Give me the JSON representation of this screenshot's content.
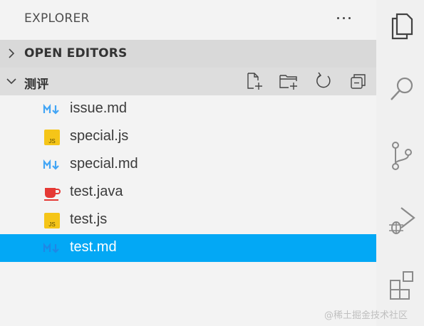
{
  "explorer": {
    "title": "EXPLORER",
    "more_icon": "ellipsis-icon"
  },
  "open_editors": {
    "label": "OPEN EDITORS",
    "expanded": false
  },
  "folder": {
    "label": "测评",
    "expanded": true,
    "tools": [
      "new-file-icon",
      "new-folder-icon",
      "refresh-icon",
      "collapse-all-icon"
    ]
  },
  "files": [
    {
      "name": "issue.md",
      "icon": "markdown-icon",
      "selected": false
    },
    {
      "name": "special.js",
      "icon": "javascript-icon",
      "selected": false
    },
    {
      "name": "special.md",
      "icon": "markdown-icon",
      "selected": false
    },
    {
      "name": "test.java",
      "icon": "java-icon",
      "selected": false
    },
    {
      "name": "test.js",
      "icon": "javascript-icon",
      "selected": false
    },
    {
      "name": "test.md",
      "icon": "markdown-icon",
      "selected": true
    }
  ],
  "activity_bar": [
    "files-icon",
    "search-icon",
    "source-control-icon",
    "run-debug-icon",
    "extensions-icon"
  ],
  "colors": {
    "background": "#f3f3f3",
    "section_header": "#d9d9d9",
    "selected_row": "#03a8f5",
    "markdown_icon": "#42a5f5",
    "js_icon": "#f5c518",
    "java_icon": "#e53935"
  },
  "watermark": "@稀土掘金技术社区"
}
